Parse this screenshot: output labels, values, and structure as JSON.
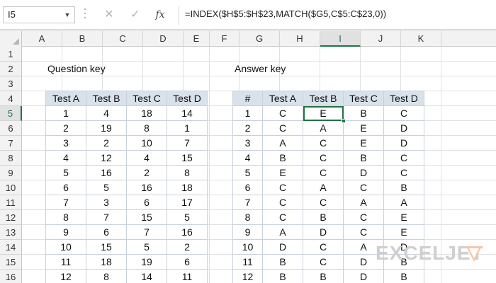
{
  "name_box": {
    "value": "I5"
  },
  "formula_bar": {
    "cancel_symbol": "✕",
    "enter_symbol": "✓",
    "fx_label": "fx",
    "formula": "=INDEX($H$5:$H$23,MATCH($G5,C$5:C$23,0))"
  },
  "columns": [
    "A",
    "B",
    "C",
    "D",
    "E",
    "F",
    "G",
    "H",
    "I",
    "J",
    "K"
  ],
  "active_column": "I",
  "rows": [
    "1",
    "2",
    "3",
    "4",
    "5",
    "6",
    "7",
    "8",
    "9",
    "10",
    "11",
    "12",
    "13",
    "14",
    "15",
    "16"
  ],
  "active_row": "5",
  "question_key": {
    "title": "Question key",
    "headers": [
      "Test A",
      "Test B",
      "Test C",
      "Test D"
    ],
    "rows": [
      [
        "1",
        "4",
        "18",
        "14"
      ],
      [
        "2",
        "19",
        "8",
        "1"
      ],
      [
        "3",
        "2",
        "10",
        "7"
      ],
      [
        "4",
        "12",
        "4",
        "15"
      ],
      [
        "5",
        "16",
        "2",
        "8"
      ],
      [
        "6",
        "5",
        "16",
        "18"
      ],
      [
        "7",
        "3",
        "6",
        "17"
      ],
      [
        "8",
        "7",
        "15",
        "5"
      ],
      [
        "9",
        "6",
        "7",
        "16"
      ],
      [
        "10",
        "15",
        "5",
        "2"
      ],
      [
        "11",
        "18",
        "19",
        "6"
      ],
      [
        "12",
        "8",
        "14",
        "11"
      ]
    ]
  },
  "answer_key": {
    "title": "Answer key",
    "headers": [
      "#",
      "Test A",
      "Test B",
      "Test C",
      "Test D"
    ],
    "rows": [
      [
        "1",
        "C",
        "E",
        "B",
        "C"
      ],
      [
        "2",
        "C",
        "A",
        "E",
        "D"
      ],
      [
        "3",
        "A",
        "C",
        "E",
        "D"
      ],
      [
        "4",
        "B",
        "C",
        "B",
        "C"
      ],
      [
        "5",
        "E",
        "C",
        "D",
        "C"
      ],
      [
        "6",
        "C",
        "A",
        "C",
        "B"
      ],
      [
        "7",
        "C",
        "C",
        "A",
        "A"
      ],
      [
        "8",
        "C",
        "B",
        "C",
        "E"
      ],
      [
        "9",
        "A",
        "D",
        "C",
        "E"
      ],
      [
        "10",
        "D",
        "C",
        "A",
        "D"
      ],
      [
        "11",
        "B",
        "C",
        "D",
        "B"
      ],
      [
        "12",
        "B",
        "B",
        "D",
        "B"
      ]
    ]
  },
  "watermark": {
    "text": "EXCELJET",
    "icon": "exceljet-logo-icon",
    "color": "#cfcfcf"
  },
  "colors": {
    "accent": "#217346",
    "header_fill": "#d9e1ea",
    "table_border": "#c9d1db"
  }
}
